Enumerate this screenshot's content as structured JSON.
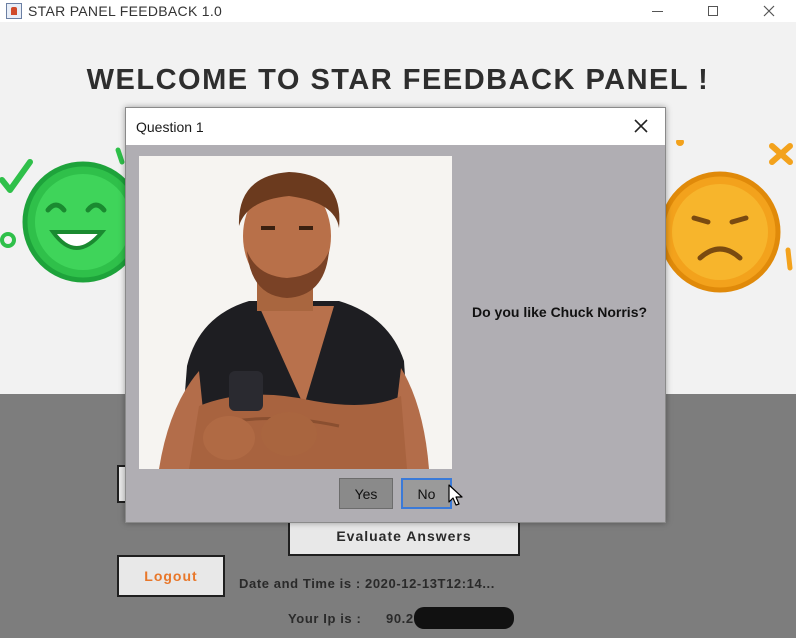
{
  "window": {
    "title": "STAR PANEL FEEDBACK 1.0"
  },
  "main": {
    "heading": "WELCOME TO STAR FEEDBACK PANEL !",
    "evaluate_label": "Evaluate Answers",
    "logout_label": "Logout",
    "datetime_text": "Date and Time is : 2020-12-13T12:14...",
    "ip_label": "Your Ip is :",
    "ip_value_visible": "90.2"
  },
  "dialog": {
    "title": "Question 1",
    "question": "Do you like Chuck Norris?",
    "yes_label": "Yes",
    "no_label": "No"
  },
  "colors": {
    "happy_face": "#2fc04a",
    "sad_face": "#f3a21c",
    "logout_text": "#e8772a",
    "bottom_panel": "#7d7d7d",
    "dialog_bg": "#b0aeb3"
  },
  "icons": [
    "app-icon",
    "minimize-icon",
    "maximize-icon",
    "close-icon",
    "happy-face-icon",
    "sad-face-icon",
    "check-icon",
    "x-mark-icon",
    "dialog-close-icon",
    "mouse-cursor-icon"
  ]
}
